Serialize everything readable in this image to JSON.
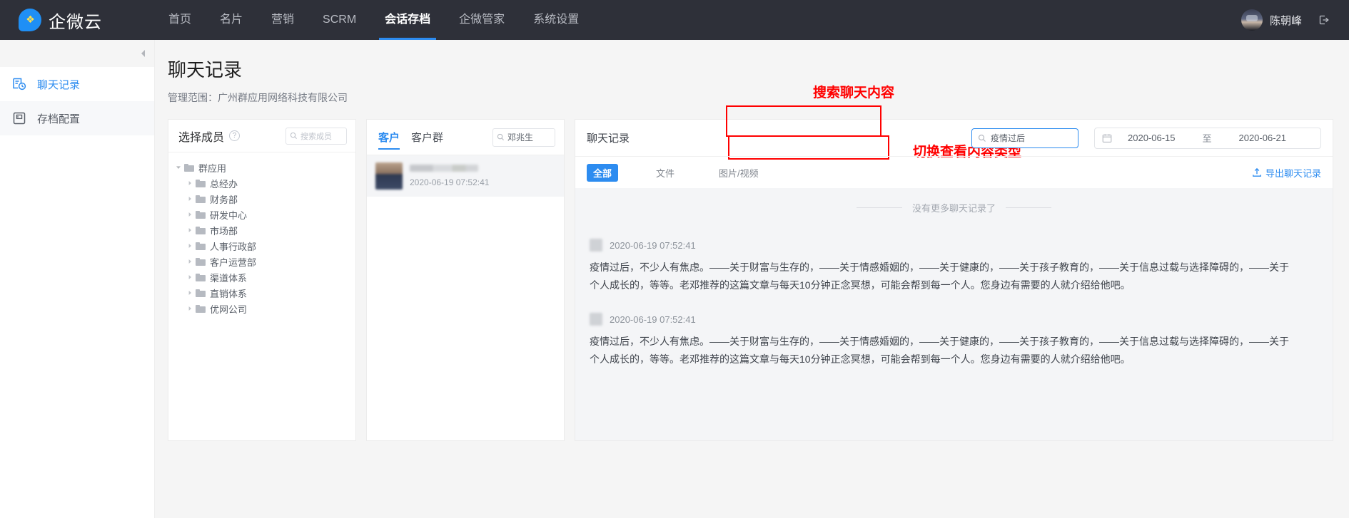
{
  "brand": {
    "name": "企微云",
    "logo_icon": "cloud-bubble-logo"
  },
  "nav": {
    "items": [
      {
        "label": "首页",
        "active": false
      },
      {
        "label": "名片",
        "active": false
      },
      {
        "label": "营销",
        "active": false
      },
      {
        "label": "SCRM",
        "active": false
      },
      {
        "label": "会话存档",
        "active": true
      },
      {
        "label": "企微管家",
        "active": false
      },
      {
        "label": "系统设置",
        "active": false
      }
    ]
  },
  "account": {
    "user_name": "陈朝峰",
    "logout_icon": "logout-icon",
    "avatar_icon": "user-avatar"
  },
  "sidebar": {
    "collapse_icon": "collapse-left-icon",
    "items": [
      {
        "label": "聊天记录",
        "icon": "chat-history-icon",
        "active": true
      },
      {
        "label": "存档配置",
        "icon": "save-disk-icon",
        "active": false
      }
    ]
  },
  "page": {
    "title": "聊天记录",
    "subtitle": "管理范围：广州群应用网络科技有限公司"
  },
  "member_panel": {
    "title": "选择成员",
    "help_icon": "question-mark-icon",
    "search": {
      "placeholder": "搜索成员",
      "icon": "search-icon"
    },
    "tree": {
      "root": {
        "label": "群应用",
        "expanded": true
      },
      "children": [
        {
          "label": "总经办"
        },
        {
          "label": "财务部"
        },
        {
          "label": "研发中心"
        },
        {
          "label": "市场部"
        },
        {
          "label": "人事行政部"
        },
        {
          "label": "客户运营部"
        },
        {
          "label": "渠道体系"
        },
        {
          "label": "直销体系"
        },
        {
          "label": "优网公司"
        }
      ]
    }
  },
  "customer_panel": {
    "tabs": [
      {
        "label": "客户",
        "active": true
      },
      {
        "label": "客户群",
        "active": false
      }
    ],
    "search": {
      "value": "邓兆生",
      "icon": "search-icon"
    },
    "list": [
      {
        "name_masked": true,
        "time": "2020-06-19 07:52:41",
        "selected": true
      }
    ]
  },
  "chat_panel": {
    "title": "聊天记录",
    "search": {
      "value": "疫情过后",
      "icon": "search-icon",
      "highlighted": true
    },
    "date_range": {
      "icon": "calendar-icon",
      "start": "2020-06-15",
      "separator": "至",
      "end": "2020-06-21"
    },
    "filters": [
      {
        "label": "全部",
        "active": true
      },
      {
        "label": "文件",
        "active": false
      },
      {
        "label": "图片/视频",
        "active": false
      }
    ],
    "export": {
      "label": "导出聊天记录",
      "icon": "upload-export-icon"
    },
    "no_more_text": "没有更多聊天记录了",
    "messages": [
      {
        "sender_masked": true,
        "time": "2020-06-19 07:52:41",
        "text": "疫情过后，不少人有焦虑。——关于财富与生存的，——关于情感婚姻的，——关于健康的，——关于孩子教育的，——关于信息过载与选择障碍的，——关于个人成长的，等等。老邓推荐的这篇文章与每天10分钟正念冥想，可能会帮到每一个人。您身边有需要的人就介绍给他吧。"
      },
      {
        "sender_masked": true,
        "time": "2020-06-19 07:52:41",
        "text": "疫情过后，不少人有焦虑。——关于财富与生存的，——关于情感婚姻的，——关于健康的，——关于孩子教育的，——关于信息过载与选择障碍的，——关于个人成长的，等等。老邓推荐的这篇文章与每天10分钟正念冥想，可能会帮到每一个人。您身边有需要的人就介绍给他吧。"
      }
    ]
  },
  "annotations": {
    "search_hint": "搜索聊天内容",
    "filter_hint": "切换查看内容类型",
    "color": "#ff0000"
  }
}
